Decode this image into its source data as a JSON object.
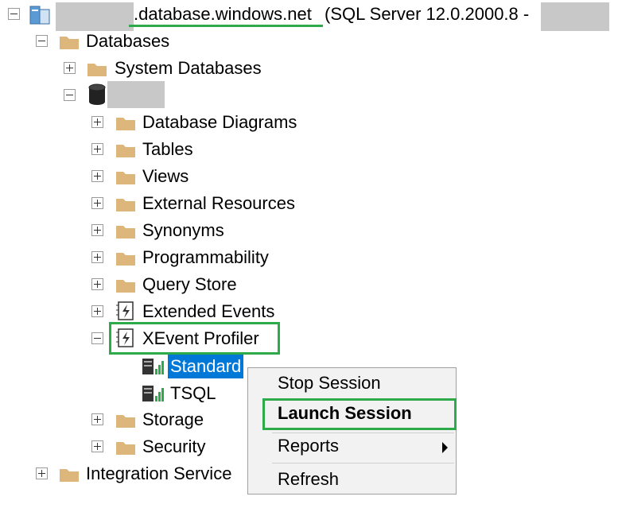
{
  "server": {
    "host_suffix": ".database.windows.net",
    "version": "(SQL Server 12.0.2000.8 -"
  },
  "tree": {
    "databases": "Databases",
    "system_databases": "System Databases",
    "database_diagrams": "Database Diagrams",
    "tables": "Tables",
    "views": "Views",
    "external_resources": "External Resources",
    "synonyms": "Synonyms",
    "programmability": "Programmability",
    "query_store": "Query Store",
    "extended_events": "Extended Events",
    "xevent_profiler": "XEvent Profiler",
    "standard": "Standard",
    "tsql": "TSQL",
    "storage": "Storage",
    "security": "Security",
    "integration_services": "Integration Service"
  },
  "context_menu": {
    "stop_session": "Stop Session",
    "launch_session": "Launch Session",
    "reports": "Reports",
    "refresh": "Refresh"
  },
  "colors": {
    "highlight": "#2eaa4a",
    "selection": "#0078d7",
    "folder": "#dcb67a"
  }
}
